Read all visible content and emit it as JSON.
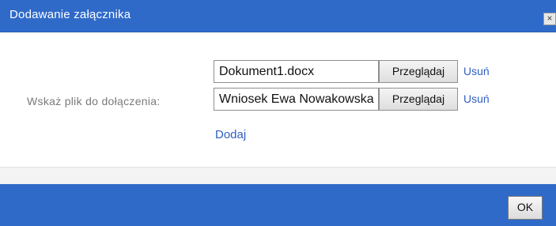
{
  "dialog": {
    "title": "Dodawanie załącznika",
    "close_label": "×"
  },
  "form": {
    "label": "Wskaż plik do dołączenia:",
    "files": [
      {
        "value": "Dokument1.docx",
        "browse_label": "Przeglądaj",
        "remove_label": "Usuń"
      },
      {
        "value": "Wniosek Ewa Nowakowska",
        "browse_label": "Przeglądaj",
        "remove_label": "Usuń"
      }
    ],
    "add_label": "Dodaj"
  },
  "footer": {
    "ok_label": "OK"
  },
  "colors": {
    "titlebar": "#2f6ac9",
    "link": "#2f5fbf"
  }
}
